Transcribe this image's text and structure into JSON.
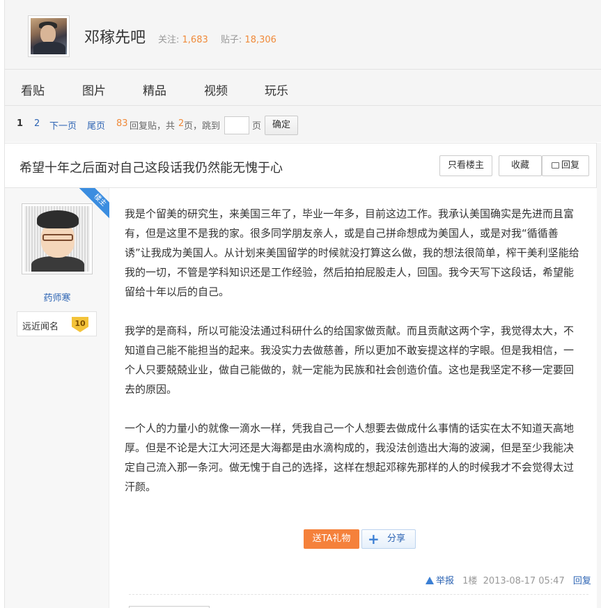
{
  "forum": {
    "name": "邓稼先吧",
    "follow_label": "关注:",
    "follow_count": "1,683",
    "posts_label": "贴子:",
    "posts_count": "18,306"
  },
  "nav": {
    "tabs": [
      "看贴",
      "图片",
      "精品",
      "视频",
      "玩乐"
    ]
  },
  "pager": {
    "current": "1",
    "page2": "2",
    "next": "下一页",
    "last": "尾页",
    "reply_count": "83",
    "reply_label": "回复贴，共",
    "total_pages": "2",
    "pages_suffix": "页，",
    "jump_label": "跳到",
    "page_unit": "页",
    "ok": "确定"
  },
  "thread": {
    "title": "希望十年之后面对自己这段话我仍然能无愧于心",
    "only_op": "只看楼主",
    "favorite": "收藏",
    "reply": "回复"
  },
  "post": {
    "op_tag": "楼主",
    "author": "药师寒",
    "badge_label": "远近闻名",
    "badge_level": "10",
    "paragraphs": [
      "我是个留美的研究生，来美国三年了，毕业一年多，目前这边工作。我承认美国确实是先进而且富有，但是这里不是我的家。很多同学朋友亲人，或是自己拼命想成为美国人，或是对我“循循善诱”让我成为美国人。从计划来美国留学的时候就没打算这么做，我的想法很简单，榨干美利坚能给我的一切，不管是学科知识还是工作经验，然后拍拍屁股走人，回国。我今天写下这段话，希望能留给十年以后的自己。",
      "我学的是商科，所以可能没法通过科研什么的给国家做贡献。而且贡献这两个字，我觉得太大，不知道自己能不能担当的起来。我没实力去做慈善，所以更加不敢妄提这样的字眼。但是我相信，一个人只要兢兢业业，做自己能做的，就一定能为民族和社会创造价值。这也是我坚定不移一定要回去的原因。",
      "一个人的力量小的就像一滴水一样，凭我自己一个人想要去做成什么事情的话实在太不知道天高地厚。但是不论是大江大河还是大海都是由水滴构成的，我没法创造出大海的波澜，但是至少我能决定自己流入那一条河。做无愧于自己的选择，这样在想起邓稼先那样的人的时候我才不会觉得太过汗颜。"
    ],
    "gift": "送TA礼物",
    "share": "分享",
    "report": "举报",
    "floor": "1楼",
    "time": "2013-08-17 05:47",
    "reply": "回复"
  },
  "colors": {
    "link": "#2d64b3",
    "accent_orange": "#f08a3a",
    "gift_button": "#f5813b",
    "op_ribbon": "#3b8de0"
  }
}
